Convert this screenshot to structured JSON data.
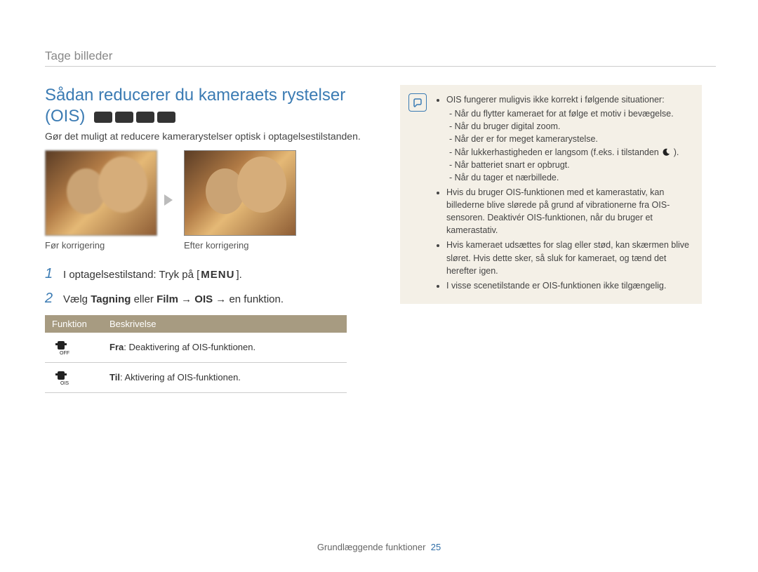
{
  "breadcrumb": "Tage billeder",
  "title_line1": "Sådan reducerer du kameraets rystelser",
  "title_line2": "(OIS)",
  "intro": "Gør det muligt at reducere kamerarystelser optisk i optagelsestilstanden.",
  "photos": {
    "before_caption": "Før korrigering",
    "after_caption": "Efter korrigering"
  },
  "steps": {
    "s1_prefix": "I optagelsestilstand: Tryk på [",
    "s1_key": "MENU",
    "s1_suffix": "].",
    "s2_prefix": "Vælg ",
    "s2_b1": "Tagning",
    "s2_mid1": " eller ",
    "s2_b2": "Film",
    "s2_mid2": " → ",
    "s2_b3": "OIS",
    "s2_suffix": " → en funktion."
  },
  "table": {
    "h1": "Funktion",
    "h2": "Beskrivelse",
    "r1_b": "Fra",
    "r1_t": ": Deaktivering af OIS-funktionen.",
    "r2_b": "Til",
    "r2_t": ": Aktivering af OIS-funktionen."
  },
  "notice": {
    "b1": "OIS fungerer muligvis ikke korrekt i følgende situationer:",
    "d1": "Når du flytter kameraet for at følge et motiv i bevægelse.",
    "d2": "Når du bruger digital zoom.",
    "d3": "Når der er for meget kamerarystelse.",
    "d4a": "Når lukkerhastigheden er langsom (f.eks. i tilstanden ",
    "d4b": " ).",
    "d5": "Når batteriet snart er opbrugt.",
    "d6": "Når du tager et nærbillede.",
    "b2": "Hvis du bruger OIS-funktionen med et kamerastativ, kan billederne blive slørede på grund af vibrationerne fra OIS-sensoren. Deaktivér OIS-funktionen, når du bruger et kamerastativ.",
    "b3": "Hvis kameraet udsættes for slag eller stød, kan skærmen blive sløret. Hvis dette sker, så sluk for kameraet, og tænd det herefter igen.",
    "b4": "I visse scenetilstande er OIS-funktionen ikke tilgængelig."
  },
  "footer": {
    "section": "Grundlæggende funktioner",
    "page": "25"
  }
}
